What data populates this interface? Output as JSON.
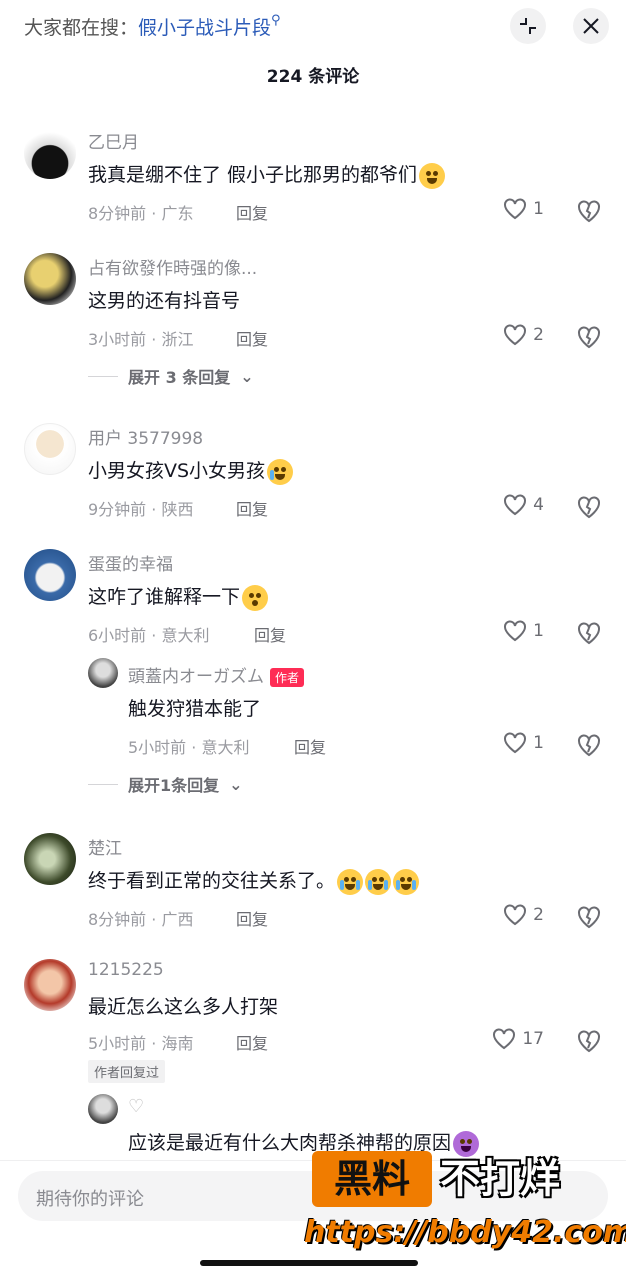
{
  "header": {
    "search_prefix": "大家都在搜：",
    "search_keyword": "假小子战斗片段",
    "comment_count_title": "224 条评论"
  },
  "comments": [
    {
      "nick": "乙巳月",
      "text": "我真是绷不住了 假小子比那男的都爷们",
      "time_loc": "8分钟前 · 广东",
      "reply": "回复",
      "likes": "1"
    },
    {
      "nick": "占有欲發作時强的像...",
      "text": "这男的还有抖音号",
      "time_loc": "3小时前 · 浙江",
      "reply": "回复",
      "likes": "2",
      "expand": "展开 3 条回复"
    },
    {
      "nick": "用户 3577998",
      "text": "小男女孩VS小女男孩",
      "time_loc": "9分钟前 · 陕西",
      "reply": "回复",
      "likes": "4"
    },
    {
      "nick": "蛋蛋的幸福",
      "text": "这咋了谁解释一下",
      "time_loc": "6小时前 · 意大利",
      "reply": "回复",
      "likes": "1",
      "sub": {
        "nick": "頭蓋内オーガズム",
        "tag": "作者",
        "text": "触发狩猎本能了",
        "time_loc": "5小时前 · 意大利",
        "reply": "回复",
        "likes": "1"
      },
      "expand": "展开1条回复"
    },
    {
      "nick": "楚江",
      "text": "终于看到正常的交往关系了。",
      "time_loc": "8分钟前 · 广西",
      "reply": "回复",
      "likes": "2"
    },
    {
      "nick": "1215225",
      "text": "最近怎么这么多人打架",
      "time_loc": "5小时前 · 海南",
      "reply": "回复",
      "likes": "17",
      "badge": "作者回复过",
      "sub": {
        "text": "应该是最近有什么大肉帮杀神帮的原因"
      }
    }
  ],
  "input": {
    "placeholder": "期待你的评论"
  },
  "watermark": {
    "box": "黑料",
    "text": "不打烊",
    "url": "https://bbdy42.com"
  },
  "colors": {
    "accent": "#fe2c55",
    "link": "#2b5bb8",
    "brand_orange": "#f07c00"
  }
}
